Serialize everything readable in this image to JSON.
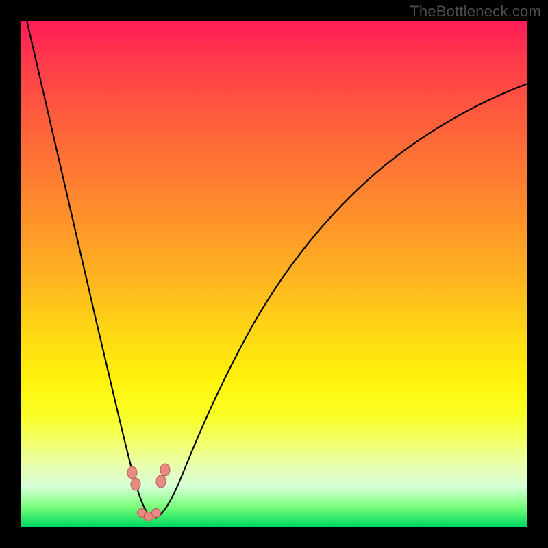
{
  "watermark": "TheBottleneck.com",
  "chart_data": {
    "type": "line",
    "title": "",
    "xlabel": "",
    "ylabel": "",
    "xlim": [
      0,
      100
    ],
    "ylim": [
      0,
      100
    ],
    "grid": false,
    "legend": false,
    "description": "Bottleneck curve: single black V-shaped curve on a vertical red-to-green gradient. Minimum (optimal, ~0% bottleneck) is near x≈25. Curve rises steeply toward 100% on both sides, reaching the top-left corner fastest and the right edge more gradually. Salmon-colored rounded markers sit along the trough of the curve.",
    "series": [
      {
        "name": "bottleneck-curve",
        "x": [
          0,
          3,
          6,
          9,
          12,
          15,
          18,
          20,
          22,
          23.5,
          25,
          26.5,
          28,
          30,
          33,
          37,
          42,
          48,
          55,
          63,
          72,
          82,
          92,
          100
        ],
        "y": [
          100,
          90,
          78,
          66,
          54,
          42,
          30,
          20,
          11,
          5,
          2,
          3,
          6,
          11,
          18,
          27,
          37,
          47,
          56,
          64,
          71,
          77,
          82,
          86
        ]
      }
    ],
    "markers": {
      "color": "#e58b82",
      "points_x": [
        22.3,
        22.8,
        27.2,
        27.8,
        24.0,
        25.0,
        26.0
      ],
      "points_y": [
        10.0,
        7.5,
        7.0,
        9.5,
        2.0,
        1.8,
        2.0
      ]
    },
    "gradient_stops": [
      {
        "pos": 0.0,
        "color": "#ff1c58"
      },
      {
        "pos": 0.3,
        "color": "#ff7a33"
      },
      {
        "pos": 0.62,
        "color": "#ffd914"
      },
      {
        "pos": 0.78,
        "color": "#f9ff26"
      },
      {
        "pos": 0.96,
        "color": "#7cff7c"
      },
      {
        "pos": 1.0,
        "color": "#00d860"
      }
    ]
  }
}
